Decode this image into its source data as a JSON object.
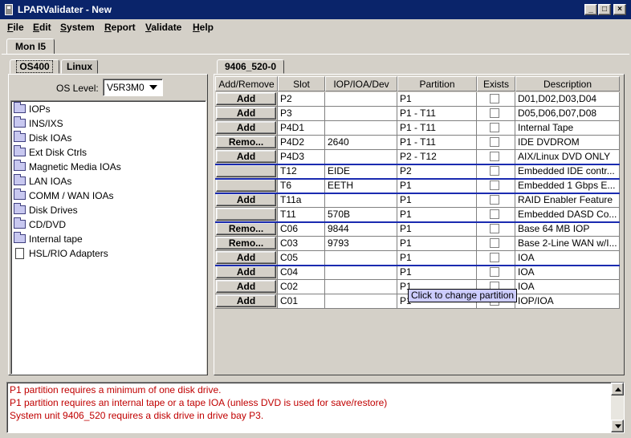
{
  "window": {
    "title": "LPARValidater - New",
    "buttons": {
      "minimize": "_",
      "maximize": "□",
      "close": "×"
    }
  },
  "menu": [
    "File",
    "Edit",
    "System",
    "Report",
    "Validate",
    "Help"
  ],
  "top_tab": "Mon I5",
  "left_panel": {
    "tabs": [
      "OS400",
      "Linux"
    ],
    "active_tab": "OS400",
    "os_level_label": "OS Level:",
    "os_level_value": "V5R3M0",
    "tree": [
      {
        "label": "IOPs",
        "icon": "folder-icon"
      },
      {
        "label": "INS/IXS",
        "icon": "folder-icon"
      },
      {
        "label": "Disk IOAs",
        "icon": "folder-icon"
      },
      {
        "label": "Ext Disk Ctrls",
        "icon": "folder-icon"
      },
      {
        "label": "Magnetic Media IOAs",
        "icon": "folder-icon"
      },
      {
        "label": "LAN IOAs",
        "icon": "folder-icon"
      },
      {
        "label": "COMM / WAN IOAs",
        "icon": "folder-icon"
      },
      {
        "label": "Disk Drives",
        "icon": "folder-icon"
      },
      {
        "label": "CD/DVD",
        "icon": "folder-icon"
      },
      {
        "label": "Internal tape",
        "icon": "folder-icon"
      },
      {
        "label": "HSL/RIO Adapters",
        "icon": "document-icon"
      }
    ]
  },
  "right_panel": {
    "tab": "9406_520-0",
    "columns": [
      "Add/Remove",
      "Slot",
      "IOP/IOA/Dev",
      "Partition",
      "Exists",
      "Description"
    ],
    "rows": [
      {
        "button": "Add",
        "slot": "P2",
        "dev": "",
        "partition": "P1",
        "exists": false,
        "description": "D01,D02,D03,D04"
      },
      {
        "button": "Add",
        "slot": "P3",
        "dev": "",
        "partition": "P1 - T11",
        "exists": false,
        "description": "D05,D06,D07,D08"
      },
      {
        "button": "Add",
        "slot": "P4D1",
        "dev": "",
        "partition": "P1 - T11",
        "exists": false,
        "description": "Internal Tape"
      },
      {
        "button": "Remo...",
        "slot": "P4D2",
        "dev": "2640",
        "partition": "P1 - T11",
        "exists": false,
        "description": "IDE DVDROM"
      },
      {
        "button": "Add",
        "slot": "P4D3",
        "dev": "",
        "partition": "P2 - T12",
        "exists": false,
        "description": "AIX/Linux DVD ONLY"
      },
      {
        "button": "",
        "slot": "T12",
        "dev": "EIDE",
        "partition": "P2",
        "exists": false,
        "description": "Embedded IDE contr..."
      },
      {
        "button": "",
        "slot": "T6",
        "dev": "EETH",
        "partition": "P1",
        "exists": false,
        "description": "Embedded 1 Gbps E..."
      },
      {
        "button": "Add",
        "slot": "T11a",
        "dev": "",
        "partition": "P1",
        "exists": false,
        "description": "RAID Enabler Feature"
      },
      {
        "button": "",
        "slot": "T11",
        "dev": "570B",
        "partition": "P1",
        "exists": false,
        "description": "Embedded DASD Co..."
      },
      {
        "button": "Remo...",
        "slot": "C06",
        "dev": "9844",
        "partition": "P1",
        "exists": false,
        "description": "Base 64 MB IOP"
      },
      {
        "button": "Remo...",
        "slot": "C03",
        "dev": "9793",
        "partition": "P1",
        "exists": false,
        "description": "Base 2-Line WAN w/I..."
      },
      {
        "button": "Add",
        "slot": "C05",
        "dev": "",
        "partition": "P1",
        "exists": false,
        "description": "IOA"
      },
      {
        "button": "Add",
        "slot": "C04",
        "dev": "",
        "partition": "P1",
        "exists": false,
        "description": "IOA"
      },
      {
        "button": "Add",
        "slot": "C02",
        "dev": "",
        "partition": "P1",
        "exists": false,
        "description": "IOA"
      },
      {
        "button": "Add",
        "slot": "C01",
        "dev": "",
        "partition": "P1",
        "exists": false,
        "description": "IOP/IOA"
      }
    ],
    "tooltip": "Click to change partition",
    "separator_color": "#1a2bb0"
  },
  "messages": [
    "P1 partition requires a minimum of one disk drive.",
    "P1 partition requires an internal tape or a tape IOA (unless DVD is used for save/restore)",
    "System unit 9406_520 requires a disk drive in drive bay P3."
  ],
  "colors": {
    "title_bar": "#0a246a",
    "message_text": "#c00000",
    "tooltip_bg": "#ccccff"
  }
}
